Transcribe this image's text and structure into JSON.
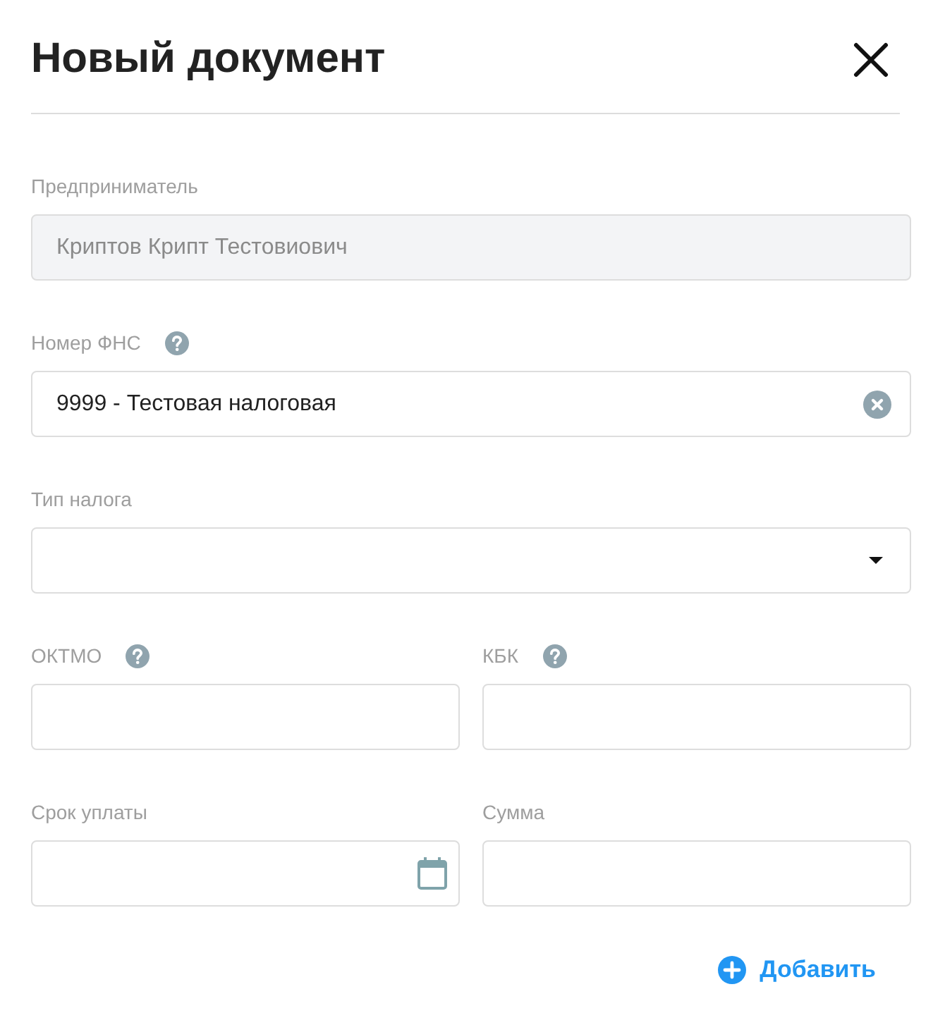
{
  "dialog": {
    "title": "Новый документ"
  },
  "rows": [
    [
      {
        "kind": "text",
        "label": "Предприниматель",
        "help": false,
        "disabled": true,
        "value": "Криптов Крипт Тестовиович"
      }
    ],
    [
      {
        "kind": "combobox",
        "label": "Номер ФНС",
        "help": true,
        "disabled": false,
        "value": "9999 - Тестовая налоговая"
      }
    ],
    [
      {
        "kind": "select",
        "label": "Тип налога",
        "help": false,
        "disabled": false
      }
    ],
    [
      {
        "kind": "text",
        "label": "ОКТМО",
        "help": true,
        "disabled": false
      },
      {
        "kind": "text",
        "label": "КБК",
        "help": true,
        "disabled": false
      }
    ],
    [
      {
        "kind": "date",
        "label": "Срок уплаты",
        "help": false,
        "disabled": false
      },
      {
        "kind": "text",
        "label": "Сумма",
        "help": false,
        "disabled": false
      }
    ]
  ],
  "add_button": {
    "label": "Добавить"
  }
}
